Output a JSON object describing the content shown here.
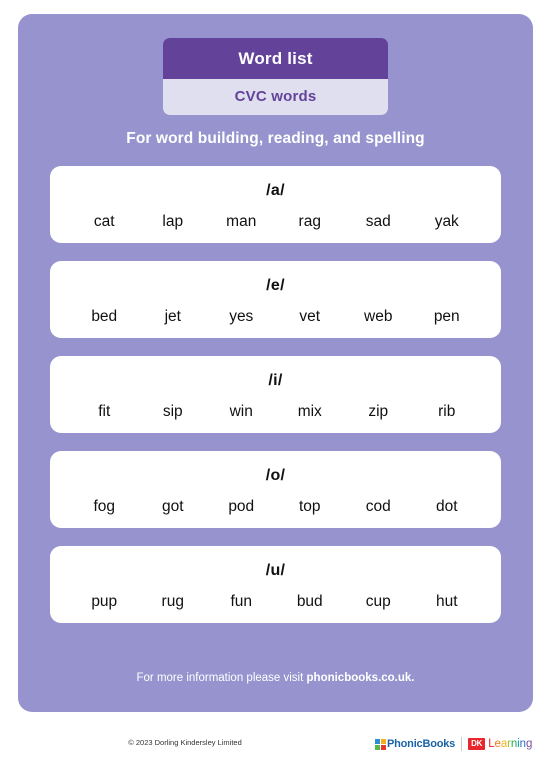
{
  "header": {
    "title": "Word list",
    "subtitle": "CVC words",
    "tagline": "For word building, reading, and spelling"
  },
  "colors": {
    "panel_background": "#9693ce",
    "header_title_background": "#63439a",
    "header_subtitle_background": "#e0dff0",
    "header_subtitle_text": "#63439a",
    "card_background": "#ffffff",
    "word_text": "#111111",
    "dk_red": "#e8262b",
    "phonicbooks_blue": "#1b63a5"
  },
  "cards": [
    {
      "sound": "/a/",
      "words": [
        "cat",
        "lap",
        "man",
        "rag",
        "sad",
        "yak"
      ]
    },
    {
      "sound": "/e/",
      "words": [
        "bed",
        "jet",
        "yes",
        "vet",
        "web",
        "pen"
      ]
    },
    {
      "sound": "/i/",
      "words": [
        "fit",
        "sip",
        "win",
        "mix",
        "zip",
        "rib"
      ]
    },
    {
      "sound": "/o/",
      "words": [
        "fog",
        "got",
        "pod",
        "top",
        "cod",
        "dot"
      ]
    },
    {
      "sound": "/u/",
      "words": [
        "pup",
        "rug",
        "fun",
        "bud",
        "cup",
        "hut"
      ]
    }
  ],
  "footer": {
    "info_prefix": "For more information please visit ",
    "info_link": "phonicbooks.co.uk.",
    "copyright": "© 2023 Dorling Kindersley Limited"
  },
  "logos": {
    "phonicbooks_text": "PhonicBooks",
    "dk_mark": "DK",
    "dk_word_letters": [
      {
        "char": "L",
        "color": "#e8262b"
      },
      {
        "char": "e",
        "color": "#f07d1a"
      },
      {
        "char": "a",
        "color": "#f5b51b"
      },
      {
        "char": "r",
        "color": "#8cc63e"
      },
      {
        "char": "n",
        "color": "#2ca84f"
      },
      {
        "char": "i",
        "color": "#00a0c6"
      },
      {
        "char": "n",
        "color": "#2a6fc4"
      },
      {
        "char": "g",
        "color": "#7a4fa3"
      }
    ]
  }
}
